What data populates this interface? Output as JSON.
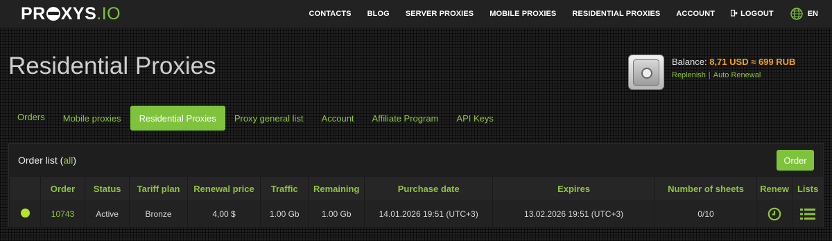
{
  "header": {
    "logo_part1": "PR",
    "logo_part2": "XYS",
    "logo_part3": ".IO",
    "nav": [
      "CONTACTS",
      "BLOG",
      "SERVER PROXIES",
      "MOBILE PROXIES",
      "RESIDENTIAL PROXIES",
      "ACCOUNT"
    ],
    "logout": "LOGOUT",
    "language": "EN"
  },
  "page": {
    "title": "Residential Proxies"
  },
  "balance": {
    "label": "Balance:",
    "amount": "8,71 USD ≈ 699 RUB",
    "replenish": "Replenish",
    "separator": "|",
    "auto_renewal": "Auto Renewal"
  },
  "tabs": [
    "Orders",
    "Mobile proxies",
    "Residential Proxies",
    "Proxy general list",
    "Account",
    "Affiliate Program",
    "API Keys"
  ],
  "panel": {
    "title": "Order list (",
    "title_link": "all",
    "title_end": ")",
    "order_button": "Order",
    "columns": [
      "",
      "Order",
      "Status",
      "Tariff plan",
      "Renewal price",
      "Traffic",
      "Remaining",
      "Purchase date",
      "Expires",
      "Number of sheets",
      "Renew",
      "Lists"
    ],
    "rows": [
      {
        "order": "10743",
        "status": "Active",
        "tariff": "Bronze",
        "renewal_price": "4,00 $",
        "traffic": "1.00 Gb",
        "remaining": "1.00 Gb",
        "purchase_date": "14.01.2026 19:51 (UTC+3)",
        "expires": "13.02.2026 19:51 (UTC+3)",
        "sheets": "0/10"
      }
    ]
  },
  "colors": {
    "accent": "#7ec33b",
    "balance": "#f0a020",
    "status_active": "#b2e62a"
  },
  "icons": [
    "logout-icon",
    "globe-icon",
    "safe-icon",
    "clock-icon",
    "list-icon",
    "status-dot-icon"
  ]
}
